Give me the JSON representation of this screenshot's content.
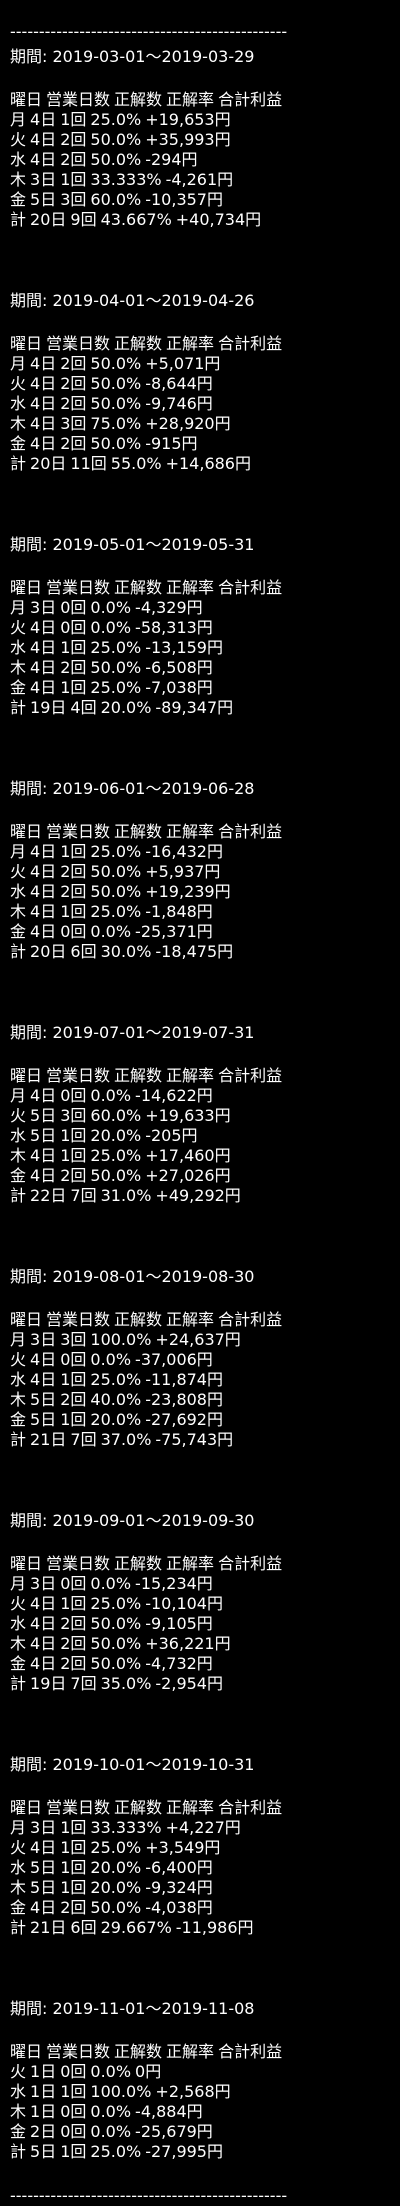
{
  "divider": "------------------------------------------------",
  "header": [
    "曜日",
    "営業日数",
    "正解数",
    "正解率",
    "合計利益"
  ],
  "periods": [
    {
      "label": "期間: 2019-03-01～2019-03-29",
      "rows": [
        [
          "月",
          "4日",
          "1回",
          "25.0%",
          "+19,653円"
        ],
        [
          "火",
          "4日",
          "2回",
          "50.0%",
          "+35,993円"
        ],
        [
          "水",
          "4日",
          "2回",
          "50.0%",
          "-294円"
        ],
        [
          "木",
          "3日",
          "1回",
          "33.333%",
          "-4,261円"
        ],
        [
          "金",
          "5日",
          "3回",
          "60.0%",
          "-10,357円"
        ],
        [
          "計",
          "20日",
          "9回",
          "43.667%",
          "+40,734円"
        ]
      ]
    },
    {
      "label": "期間: 2019-04-01～2019-04-26",
      "rows": [
        [
          "月",
          "4日",
          "2回",
          "50.0%",
          "+5,071円"
        ],
        [
          "火",
          "4日",
          "2回",
          "50.0%",
          "-8,644円"
        ],
        [
          "水",
          "4日",
          "2回",
          "50.0%",
          "-9,746円"
        ],
        [
          "木",
          "4日",
          "3回",
          "75.0%",
          "+28,920円"
        ],
        [
          "金",
          "4日",
          "2回",
          "50.0%",
          "-915円"
        ],
        [
          "計",
          "20日",
          "11回",
          "55.0%",
          "+14,686円"
        ]
      ]
    },
    {
      "label": "期間: 2019-05-01～2019-05-31",
      "rows": [
        [
          "月",
          "3日",
          "0回",
          "0.0%",
          "-4,329円"
        ],
        [
          "火",
          "4日",
          "0回",
          "0.0%",
          "-58,313円"
        ],
        [
          "水",
          "4日",
          "1回",
          "25.0%",
          "-13,159円"
        ],
        [
          "木",
          "4日",
          "2回",
          "50.0%",
          "-6,508円"
        ],
        [
          "金",
          "4日",
          "1回",
          "25.0%",
          "-7,038円"
        ],
        [
          "計",
          "19日",
          "4回",
          "20.0%",
          "-89,347円"
        ]
      ]
    },
    {
      "label": "期間: 2019-06-01～2019-06-28",
      "rows": [
        [
          "月",
          "4日",
          "1回",
          "25.0%",
          "-16,432円"
        ],
        [
          "火",
          "4日",
          "2回",
          "50.0%",
          "+5,937円"
        ],
        [
          "水",
          "4日",
          "2回",
          "50.0%",
          "+19,239円"
        ],
        [
          "木",
          "4日",
          "1回",
          "25.0%",
          "-1,848円"
        ],
        [
          "金",
          "4日",
          "0回",
          "0.0%",
          "-25,371円"
        ],
        [
          "計",
          "20日",
          "6回",
          "30.0%",
          "-18,475円"
        ]
      ]
    },
    {
      "label": "期間: 2019-07-01～2019-07-31",
      "rows": [
        [
          "月",
          "4日",
          "0回",
          "0.0%",
          "-14,622円"
        ],
        [
          "火",
          "5日",
          "3回",
          "60.0%",
          "+19,633円"
        ],
        [
          "水",
          "5日",
          "1回",
          "20.0%",
          "-205円"
        ],
        [
          "木",
          "4日",
          "1回",
          "25.0%",
          "+17,460円"
        ],
        [
          "金",
          "4日",
          "2回",
          "50.0%",
          "+27,026円"
        ],
        [
          "計",
          "22日",
          "7回",
          "31.0%",
          "+49,292円"
        ]
      ]
    },
    {
      "label": "期間: 2019-08-01～2019-08-30",
      "rows": [
        [
          "月",
          "3日",
          "3回",
          "100.0%",
          "+24,637円"
        ],
        [
          "火",
          "4日",
          "0回",
          "0.0%",
          "-37,006円"
        ],
        [
          "水",
          "4日",
          "1回",
          "25.0%",
          "-11,874円"
        ],
        [
          "木",
          "5日",
          "2回",
          "40.0%",
          "-23,808円"
        ],
        [
          "金",
          "5日",
          "1回",
          "20.0%",
          "-27,692円"
        ],
        [
          "計",
          "21日",
          "7回",
          "37.0%",
          "-75,743円"
        ]
      ]
    },
    {
      "label": "期間: 2019-09-01～2019-09-30",
      "rows": [
        [
          "月",
          "3日",
          "0回",
          "0.0%",
          "-15,234円"
        ],
        [
          "火",
          "4日",
          "1回",
          "25.0%",
          "-10,104円"
        ],
        [
          "水",
          "4日",
          "2回",
          "50.0%",
          "-9,105円"
        ],
        [
          "木",
          "4日",
          "2回",
          "50.0%",
          "+36,221円"
        ],
        [
          "金",
          "4日",
          "2回",
          "50.0%",
          "-4,732円"
        ],
        [
          "計",
          "19日",
          "7回",
          "35.0%",
          "-2,954円"
        ]
      ]
    },
    {
      "label": "期間: 2019-10-01～2019-10-31",
      "rows": [
        [
          "月",
          "3日",
          "1回",
          "33.333%",
          "+4,227円"
        ],
        [
          "火",
          "4日",
          "1回",
          "25.0%",
          "+3,549円"
        ],
        [
          "水",
          "5日",
          "1回",
          "20.0%",
          "-6,400円"
        ],
        [
          "木",
          "5日",
          "1回",
          "20.0%",
          "-9,324円"
        ],
        [
          "金",
          "4日",
          "2回",
          "50.0%",
          "-4,038円"
        ],
        [
          "計",
          "21日",
          "6回",
          "29.667%",
          "-11,986円"
        ]
      ]
    },
    {
      "label": "期間: 2019-11-01～2019-11-08",
      "rows": [
        [
          "火",
          "1日",
          "0回",
          "0.0%",
          "0円"
        ],
        [
          "水",
          "1日",
          "1回",
          "100.0%",
          "+2,568円"
        ],
        [
          "木",
          "1日",
          "0回",
          "0.0%",
          "-4,884円"
        ],
        [
          "金",
          "2日",
          "0回",
          "0.0%",
          "-25,679円"
        ],
        [
          "計",
          "5日",
          "1回",
          "25.0%",
          "-27,995円"
        ]
      ]
    }
  ]
}
